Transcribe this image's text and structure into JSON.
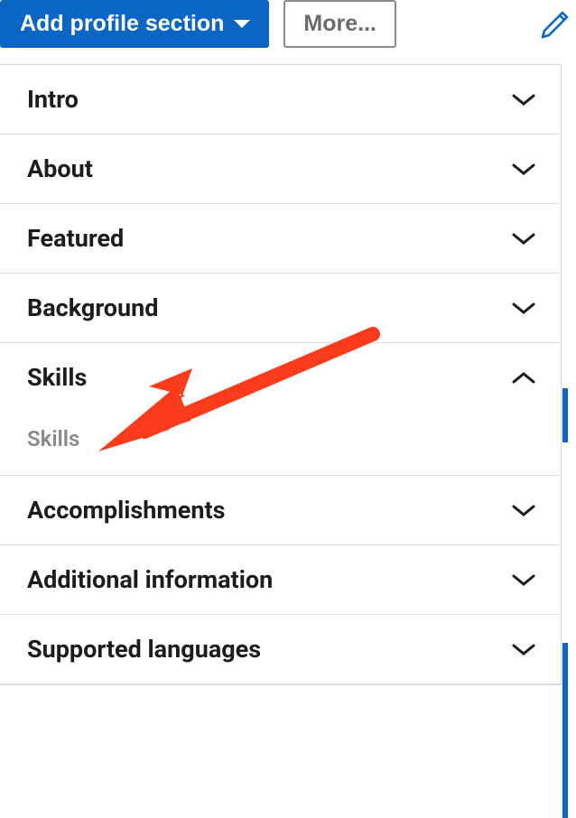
{
  "toolbar": {
    "primary_label": "Add profile section",
    "secondary_label": "More...",
    "edit_icon": "pencil-icon"
  },
  "sections": [
    {
      "label": "Intro",
      "expanded": false
    },
    {
      "label": "About",
      "expanded": false
    },
    {
      "label": "Featured",
      "expanded": false
    },
    {
      "label": "Background",
      "expanded": false
    },
    {
      "label": "Skills",
      "expanded": true,
      "sub_items": [
        "Skills"
      ]
    },
    {
      "label": "Accomplishments",
      "expanded": false
    },
    {
      "label": "Additional information",
      "expanded": false
    },
    {
      "label": "Supported languages",
      "expanded": false
    }
  ],
  "annotation": {
    "arrow_color": "#fb3c1c"
  }
}
